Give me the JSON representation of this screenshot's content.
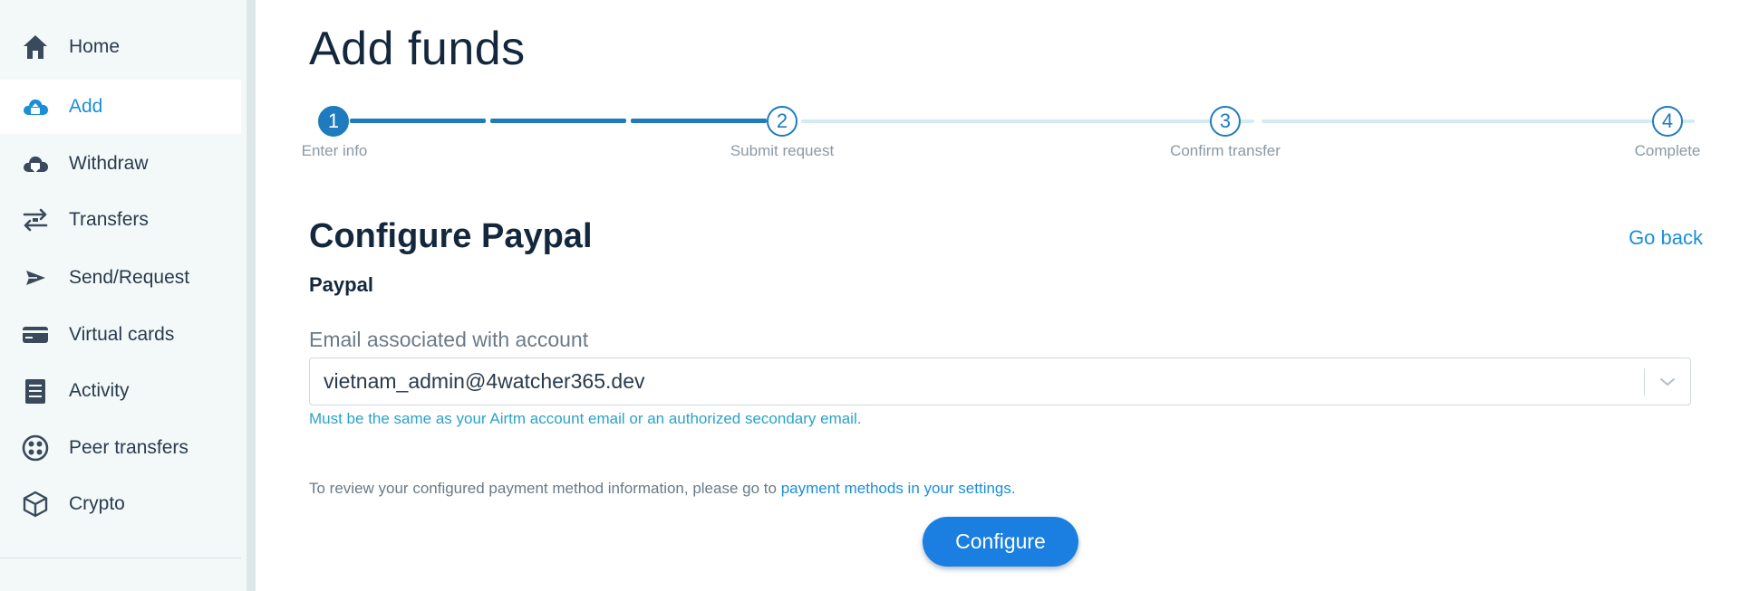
{
  "sidebar": {
    "items": [
      {
        "label": "Home",
        "icon": "home-icon",
        "active": false
      },
      {
        "label": "Add",
        "icon": "cloud-upload-icon",
        "active": true
      },
      {
        "label": "Withdraw",
        "icon": "cloud-download-icon",
        "active": false
      },
      {
        "label": "Transfers",
        "icon": "transfer-arrows-icon",
        "active": false
      },
      {
        "label": "Send/Request",
        "icon": "send-icon",
        "active": false
      },
      {
        "label": "Virtual cards",
        "icon": "card-icon",
        "active": false
      },
      {
        "label": "Activity",
        "icon": "document-list-icon",
        "active": false
      },
      {
        "label": "Peer transfers",
        "icon": "peer-circles-icon",
        "active": false
      },
      {
        "label": "Crypto",
        "icon": "cube-icon",
        "active": false
      }
    ]
  },
  "page": {
    "title": "Add funds"
  },
  "stepper": {
    "steps": [
      {
        "number": "1",
        "label": "Enter info",
        "state": "active"
      },
      {
        "number": "2",
        "label": "Submit request",
        "state": "pending"
      },
      {
        "number": "3",
        "label": "Confirm transfer",
        "state": "pending"
      },
      {
        "number": "4",
        "label": "Complete",
        "state": "pending"
      }
    ]
  },
  "form": {
    "section_title": "Configure Paypal",
    "go_back": "Go back",
    "method_name": "Paypal",
    "email_label": "Email associated with account",
    "email_value": "vietnam_admin@4watcher365.dev",
    "helper": "Must be the same as your Airtm account email or an authorized secondary email.",
    "review_prefix": "To review your configured payment method information, please go to ",
    "review_link": "payment methods in your settings.",
    "configure_label": "Configure"
  },
  "colors": {
    "accent": "#1a8fd8",
    "stepper_done": "#1f7bbd",
    "stepper_pending": "#d2ebf5",
    "button": "#1a7fe0",
    "sidebar_bg": "#f3f9f9"
  }
}
